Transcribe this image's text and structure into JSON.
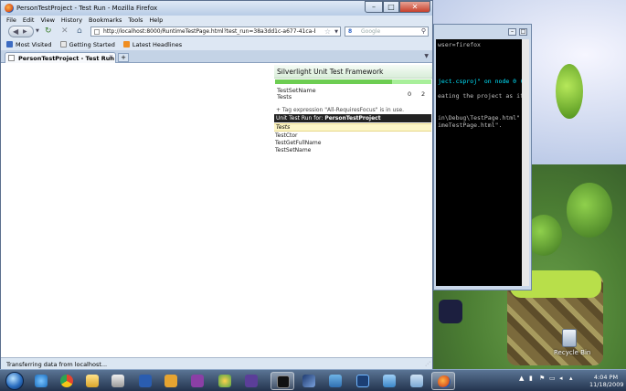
{
  "browser": {
    "window_title": "PersonTestProject - Test Run - Mozilla Firefox",
    "menu": [
      "File",
      "Edit",
      "View",
      "History",
      "Bookmarks",
      "Tools",
      "Help"
    ],
    "url": "http://localhost:8000/RuntimeTestPage.html?test_run=38a3dd1c-a677-41ca-b384-349e60596e3",
    "search_placeholder": "Google",
    "search_engine_glyph": "8",
    "bookmarks": [
      "Most Visited",
      "Getting Started",
      "Latest Headlines"
    ],
    "tab_title": "PersonTestProject - Test Run",
    "new_tab_label": "+",
    "status_text": "Transferring data from localhost..."
  },
  "test_framework": {
    "header": "Silverlight Unit Test Framework",
    "progress_fraction": 0.75,
    "rows": [
      {
        "label": "TestSetName",
        "a": "",
        "b": ""
      },
      {
        "label": "Tests",
        "a": "0",
        "b": "2"
      }
    ],
    "tag_expression": "+ Tag expression \"All-RequiresFocus\" is in use.",
    "run_prefix": "Unit Test Run for",
    "run_project": "PersonTestProject",
    "tests_header": "Tests",
    "tests": [
      "TestCtor",
      "TestGetFullName",
      "TestSetName"
    ]
  },
  "console": {
    "lines": [
      {
        "text": "wser=firefox",
        "cyan": false
      },
      {
        "text": "",
        "cyan": false
      },
      {
        "text": "",
        "cyan": false
      },
      {
        "text": "",
        "cyan": false
      },
      {
        "text": "",
        "cyan": false
      },
      {
        "text": "ject.csproj\" on node 0 (",
        "cyan": true
      },
      {
        "text": "",
        "cyan": false
      },
      {
        "text": "eating the project as if",
        "cyan": false
      },
      {
        "text": "",
        "cyan": false
      },
      {
        "text": "",
        "cyan": false
      },
      {
        "text": "in\\Debug\\TestPage.html\"",
        "cyan": false
      },
      {
        "text": "imeTestPage.html\".",
        "cyan": false
      }
    ]
  },
  "desktop": {
    "recycle_bin_label": "Recycle Bin"
  },
  "taskbar": {
    "time": "4:04 PM",
    "date": "11/18/2009"
  },
  "colors": {
    "progress_bg": "#a8ef9a",
    "progress_fill": "#6dcd52",
    "run_bar": "#222222",
    "tests_header_bg": "#fdf6c8"
  }
}
